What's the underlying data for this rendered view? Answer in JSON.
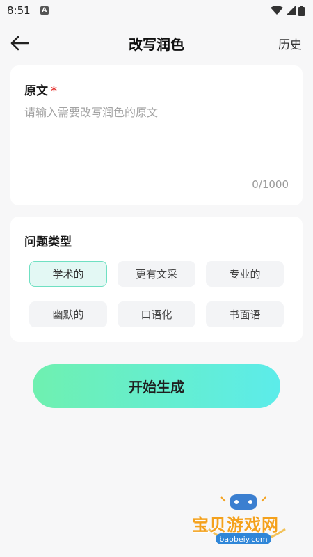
{
  "status_bar": {
    "time": "8:51",
    "notification_icon": "a-letter-icon"
  },
  "app_bar": {
    "title": "改写润色",
    "history_label": "历史"
  },
  "original": {
    "label": "原文",
    "required_mark": "*",
    "placeholder": "请输入需要改写润色的原文",
    "value": "",
    "counter": "0/1000"
  },
  "types": {
    "label": "问题类型",
    "chips": [
      {
        "label": "学术的",
        "selected": true
      },
      {
        "label": "更有文采",
        "selected": false
      },
      {
        "label": "专业的",
        "selected": false
      },
      {
        "label": "幽默的",
        "selected": false
      },
      {
        "label": "口语化",
        "selected": false
      },
      {
        "label": "书面语",
        "selected": false
      }
    ]
  },
  "generate_button": {
    "label": "开始生成"
  },
  "watermark": {
    "text": "宝贝游戏网",
    "url": "baobeiy.com"
  },
  "colors": {
    "accent_start": "#6ff0b0",
    "accent_end": "#5cecea",
    "selected_chip_bg": "#e3f8f4",
    "selected_chip_border": "#6fe0c2",
    "required": "#e53935"
  }
}
